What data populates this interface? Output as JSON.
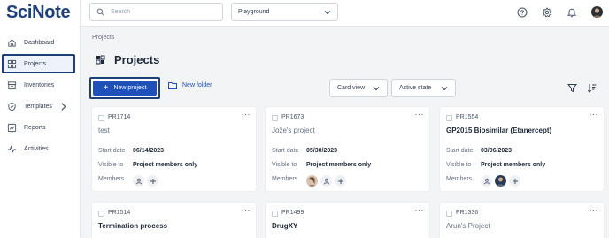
{
  "app": {
    "logo": "SciNote"
  },
  "sidebar": {
    "items": [
      {
        "label": "Dashboard",
        "icon": "home-icon"
      },
      {
        "label": "Projects",
        "icon": "grid-icon",
        "active": true
      },
      {
        "label": "Inventories",
        "icon": "inventory-icon"
      },
      {
        "label": "Templates",
        "icon": "shield-icon"
      },
      {
        "label": "Reports",
        "icon": "reports-icon"
      },
      {
        "label": "Activities",
        "icon": "activity-icon"
      }
    ]
  },
  "header": {
    "search_placeholder": "Search",
    "team": "Playground",
    "icons": [
      "help-icon",
      "settings-icon",
      "notifications-icon",
      "user-avatar"
    ]
  },
  "main": {
    "breadcrumb": "Projects",
    "title": "Projects",
    "new_project_label": "New project",
    "new_folder_label": "New folder",
    "view_select": "Card view",
    "state_select": "Active state"
  },
  "labels": {
    "start_date": "Start date",
    "visible_to": "Visible to",
    "members": "Members"
  },
  "cards": [
    {
      "code": "PR1714",
      "name": "test",
      "name_style": "muted",
      "start_date": "06/14/2023",
      "visible_to": "Project members only"
    },
    {
      "code": "PR1673",
      "name": "Jože's project",
      "name_style": "muted",
      "start_date": "05/30/2023",
      "visible_to": "Project members only"
    },
    {
      "code": "PR1554",
      "name": "GP2015 Biosimilar (Etanercept)",
      "name_style": "bold",
      "start_date": "03/06/2023",
      "visible_to": "Project members only"
    },
    {
      "code": "PR1514",
      "name": "Termination process",
      "name_style": "bold"
    },
    {
      "code": "PR1499",
      "name": "DrugXY",
      "name_style": "bold"
    },
    {
      "code": "PR1336",
      "name": "Arun's Project",
      "name_style": "muted"
    }
  ],
  "colors": {
    "brand": "#1d3f7a",
    "primary": "#1f4fb8",
    "background": "#f3f4f6"
  }
}
